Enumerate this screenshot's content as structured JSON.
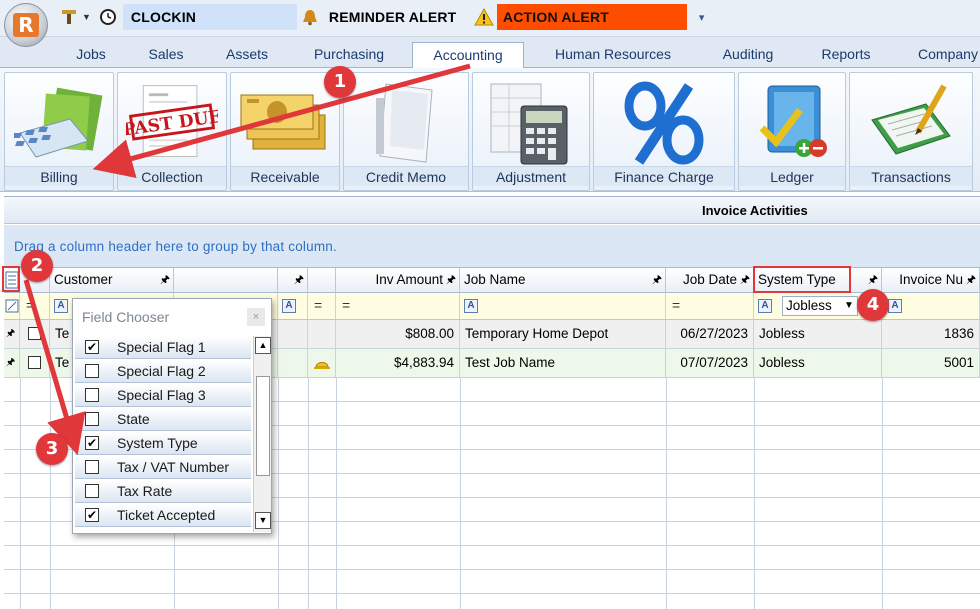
{
  "qat": {
    "clock_label": "CLOCKIN",
    "reminder_label": "REMINDER ALERT",
    "action_label": "ACTION ALERT",
    "colors": {
      "clock_bg": "#cfe2fa",
      "action_bg": "#ff4d00"
    }
  },
  "tabs": [
    "Jobs",
    "Sales",
    "Assets",
    "Purchasing",
    "Accounting",
    "Human Resources",
    "Auditing",
    "Reports",
    "Company"
  ],
  "active_tab": "Accounting",
  "ribbon": [
    "Billing",
    "Collection",
    "Receivable",
    "Credit Memo",
    "Adjustment",
    "Finance Charge",
    "Ledger",
    "Transactions"
  ],
  "ribbon_art": {
    "collection_stamp": "PAST DUE"
  },
  "grid": {
    "caption": "Invoice Activities",
    "group_by_hint": "Drag a column header here to group by that column.",
    "columns": {
      "customer": "Customer",
      "inv_amount": "Inv Amount",
      "job_name": "Job Name",
      "job_date": "Job Date",
      "system_type": "System Type",
      "invoice_no": "Invoice Nu"
    },
    "filter": {
      "system_type_value": "Jobless"
    },
    "rows": [
      {
        "customer": "Te",
        "inv_amount": "$808.00",
        "job_name": "Temporary Home Depot",
        "job_date": "06/27/2023",
        "system_type": "Jobless",
        "invoice_no": "1836"
      },
      {
        "customer": "Te",
        "inv_amount": "$4,883.94",
        "job_name": "Test Job Name",
        "job_date": "07/07/2023",
        "system_type": "Jobless",
        "invoice_no": "5001"
      }
    ]
  },
  "field_chooser": {
    "title": "Field Chooser",
    "close": "×",
    "items": [
      {
        "label": "Special Flag 1",
        "checked": true
      },
      {
        "label": "Special Flag 2",
        "checked": false
      },
      {
        "label": "Special Flag 3",
        "checked": false
      },
      {
        "label": "State",
        "checked": false
      },
      {
        "label": "System Type",
        "checked": true
      },
      {
        "label": "Tax / VAT Number",
        "checked": false
      },
      {
        "label": "Tax Rate",
        "checked": false
      },
      {
        "label": "Ticket Accepted",
        "checked": true
      }
    ]
  },
  "annotations": {
    "m1": "1",
    "m2": "2",
    "m3": "3",
    "m4": "4",
    "color": "#e0373b"
  }
}
